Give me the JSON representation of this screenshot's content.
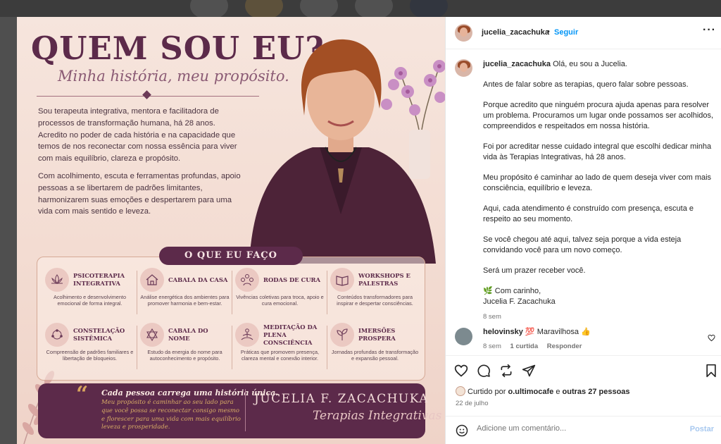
{
  "post_image": {
    "title": "QUEM SOU EU?",
    "subtitle": "Minha história, meu propósito.",
    "intro_paragraphs": [
      "Sou terapeuta integrativa, mentora e facilitadora de processos de transformação humana, há 28 anos. Acredito no poder de cada história e na capacidade que temos de nos reconectar com nossa essência para viver com mais equilíbrio, clareza e propósito.",
      "Com acolhimento, escuta e ferramentas profundas, apoio pessoas a se libertarem de padrões limitantes, harmonizarem suas emoções e despertarem para uma vida com mais sentido e leveza."
    ],
    "section_label": "O QUE EU FAÇO",
    "services": [
      {
        "icon": "lotus-icon",
        "title": "PSICOTERAPIA INTEGRATIVA",
        "desc": "Acolhimento e desenvolvimento emocional de forma integral."
      },
      {
        "icon": "house-icon",
        "title": "CABALA DA CASA",
        "desc": "Análise energética dos ambientes para promover harmonia e bem-estar."
      },
      {
        "icon": "people-circle-icon",
        "title": "RODAS DE CURA",
        "desc": "Vivências coletivas para troca, apoio e cura emocional."
      },
      {
        "icon": "book-icon",
        "title": "WORKSHOPS E PALESTRAS",
        "desc": "Conteúdos transformadores para inspirar e despertar consciências."
      },
      {
        "icon": "constellation-icon",
        "title": "CONSTELAÇÃO SISTÊMICA",
        "desc": "Compreensão de padrões familiares e libertação de bloqueios."
      },
      {
        "icon": "star-of-david-icon",
        "title": "CABALA DO NOME",
        "desc": "Estudo da energia do nome para autoconhecimento e propósito."
      },
      {
        "icon": "meditation-icon",
        "title": "MEDITAÇÃO DA PLENA CONSCIÊNCIA",
        "desc": "Práticas que promovem presença, clareza mental e conexão interior."
      },
      {
        "icon": "sprout-icon",
        "title": "IMERSÕES PROSPERA",
        "desc": "Jornadas profundas de transformação e expansão pessoal."
      }
    ],
    "quote_marks": "“",
    "quote_title": "Cada pessoa carrega uma história única.",
    "quote_body": "Meu propósito é caminhar ao seu lado para que você possa se reconectar consigo mesmo e florescer para uma vida com mais equilíbrio leveza e prosperidade.",
    "signature_name": "JUCELIA F. ZACACHUKA",
    "signature_subtitle": "Terapias Integrativas"
  },
  "panel": {
    "username": "jucelia_zacachuka",
    "separator": "•",
    "follow_label": "Seguir",
    "more_label": "···",
    "caption_user": "jucelia_zacachuka",
    "caption_first": "Olá, eu sou a Jucelia.",
    "caption_paragraphs": [
      "Antes de falar sobre as terapias, quero falar sobre pessoas.",
      "Porque acredito que ninguém procura ajuda apenas para resolver um problema. Procuramos um lugar onde possamos ser acolhidos, compreendidos e respeitados em nossa história.",
      "Foi por acreditar nesse cuidado integral que escolhi dedicar minha vida às Terapias Integrativas, há 28 anos.",
      "Meu propósito é caminhar ao lado de quem deseja viver com mais consciência, equilíbrio e leveza.",
      "Aqui, cada atendimento é construído com presença, escuta e respeito ao seu momento.",
      "Se você chegou até aqui, talvez seja porque a vida esteja convidando você para um novo começo.",
      "Será um prazer receber você."
    ],
    "signoff_emoji": "🌿",
    "signoff_line1": "Com carinho,",
    "signoff_line2": "Jucelia F. Zacachuka",
    "caption_time": "8 sem",
    "comment": {
      "user": "helovinsky",
      "text_emoji1": "💯",
      "text": "Maravilhosa",
      "text_emoji2": "👍",
      "time": "8 sem",
      "likes": "1 curtida",
      "reply": "Responder"
    },
    "liked_by_prefix": "Curtido por",
    "liked_by_user": "o.ultimocafe",
    "liked_by_suffix": "e",
    "liked_by_others": "outras 27 pessoas",
    "date": "22 de julho",
    "comment_placeholder": "Adicione um comentário...",
    "post_label": "Postar"
  },
  "colors": {
    "plum": "#5c2a4a",
    "gold": "#d9ad66",
    "ig_blue": "#0095f6"
  }
}
